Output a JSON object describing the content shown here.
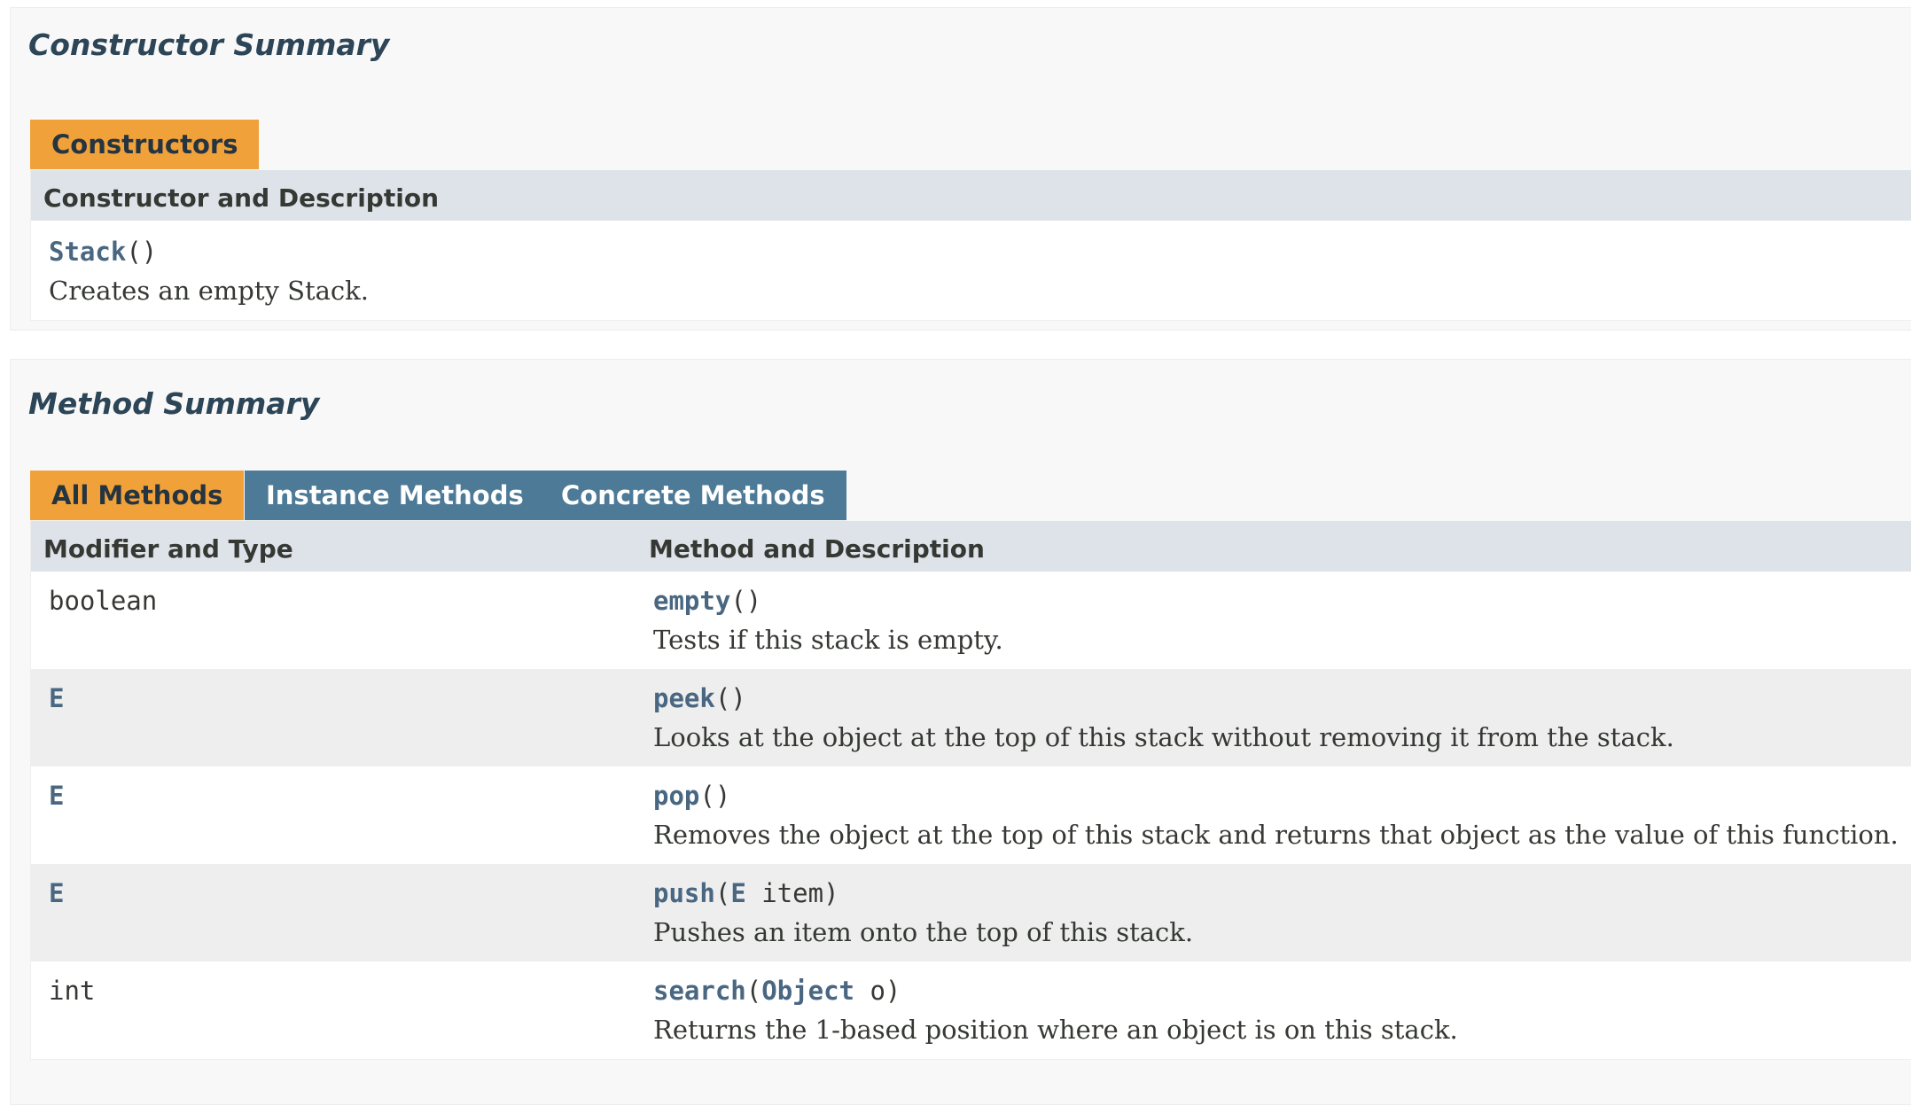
{
  "constructor_summary": {
    "heading": "Constructor Summary",
    "tab_label": "Constructors",
    "column_header": "Constructor and Description",
    "rows": [
      {
        "name": "Stack",
        "params_open": "(",
        "params_close": ")",
        "description": "Creates an empty Stack."
      }
    ]
  },
  "method_summary": {
    "heading": "Method Summary",
    "tabs": [
      {
        "label": "All Methods",
        "active": true
      },
      {
        "label": "Instance Methods",
        "active": false
      },
      {
        "label": "Concrete Methods",
        "active": false
      }
    ],
    "columns": [
      "Modifier and Type",
      "Method and Description"
    ],
    "rows": [
      {
        "type": "boolean",
        "type_is_link": false,
        "name": "empty",
        "params_open": "(",
        "param_type": "",
        "param_rest": "",
        "params_close": ")",
        "description": "Tests if this stack is empty."
      },
      {
        "type": "E",
        "type_is_link": true,
        "name": "peek",
        "params_open": "(",
        "param_type": "",
        "param_rest": "",
        "params_close": ")",
        "description": "Looks at the object at the top of this stack without removing it from the stack."
      },
      {
        "type": "E",
        "type_is_link": true,
        "name": "pop",
        "params_open": "(",
        "param_type": "",
        "param_rest": "",
        "params_close": ")",
        "description": "Removes the object at the top of this stack and returns that object as the value of this function."
      },
      {
        "type": "E",
        "type_is_link": true,
        "name": "push",
        "params_open": "(",
        "param_type": "E",
        "param_rest": " item",
        "params_close": ")",
        "description": "Pushes an item onto the top of this stack."
      },
      {
        "type": "int",
        "type_is_link": false,
        "name": "search",
        "params_open": "(",
        "param_type": "Object",
        "param_rest": " o",
        "params_close": ")",
        "description": "Returns the 1-based position where an object is on this stack."
      }
    ]
  },
  "colors": {
    "tab_active": "#f0a13a",
    "tab_inactive": "#4d7a97",
    "header_row": "#dee3e9",
    "alt_row": "#eeeeef",
    "link": "#4a6782"
  }
}
